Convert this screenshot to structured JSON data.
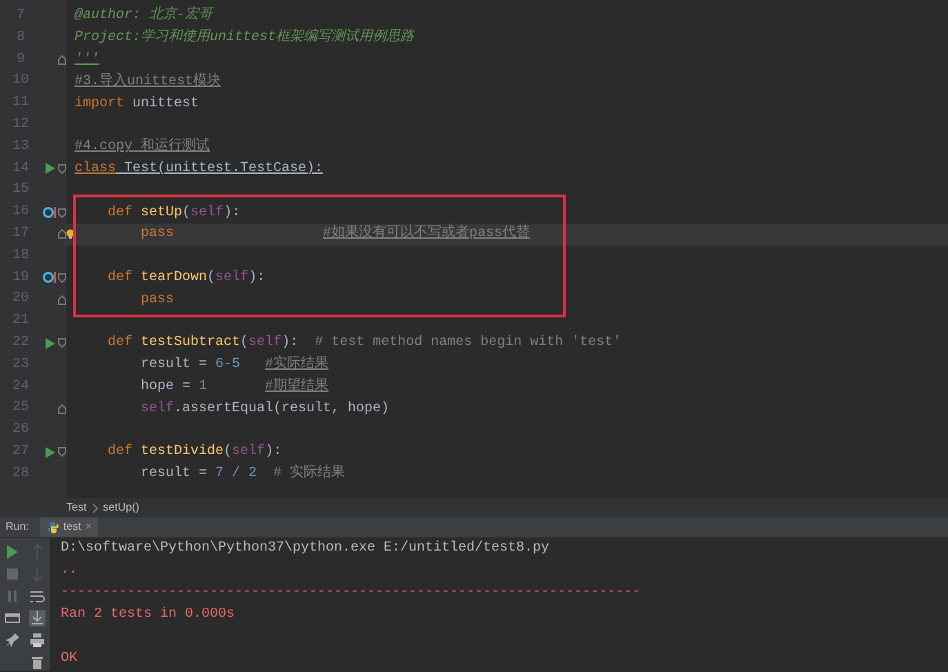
{
  "editor": {
    "items": [
      {
        "kind": "line",
        "number": "7",
        "current": false,
        "tokens": [
          {
            "text": "@author: 北京-宏哥",
            "kind": "docstring",
            "underlined": false
          }
        ]
      },
      {
        "kind": "line",
        "number": "8",
        "current": false,
        "tokens": [
          {
            "text": "Project:学习和使用unittest框架编写测试用例思路",
            "kind": "docstring",
            "underlined": false
          }
        ]
      },
      {
        "kind": "line",
        "number": "9",
        "current": false,
        "gutter_icons": [
          {
            "kind": "fold-end"
          }
        ],
        "tokens": [
          {
            "text": "'''",
            "kind": "docstring",
            "underlined": true
          }
        ]
      },
      {
        "kind": "line",
        "number": "10",
        "current": false,
        "tokens": [
          {
            "text": "#3.导入unittest模块",
            "kind": "comment",
            "underlined": true
          }
        ]
      },
      {
        "kind": "line",
        "number": "11",
        "current": false,
        "tokens": [
          {
            "text": "import ",
            "kind": "keyword",
            "underlined": false
          },
          {
            "text": "unittest",
            "kind": "plain",
            "underlined": false
          }
        ]
      },
      {
        "kind": "line",
        "number": "12",
        "current": false
      },
      {
        "kind": "line",
        "number": "13",
        "current": false,
        "tokens": [
          {
            "text": "#4.copy 和运行测试",
            "kind": "comment",
            "underlined": true
          }
        ]
      },
      {
        "kind": "line",
        "number": "14",
        "current": false,
        "gutter_icons": [
          {
            "kind": "run"
          },
          {
            "kind": "fold-start"
          }
        ],
        "tokens": [
          {
            "text": "class",
            "kind": "keyword",
            "underlined": true
          },
          {
            "text": " Test(unittest.TestCase):",
            "kind": "plain",
            "underlined": true
          }
        ]
      },
      {
        "kind": "line",
        "number": "15",
        "current": false
      },
      {
        "kind": "frame",
        "lines": [
          {
            "kind": "line",
            "number": "16",
            "current": false,
            "gutter_icons": [
              {
                "kind": "override"
              },
              {
                "kind": "fold-start"
              }
            ],
            "tokens": [
              {
                "text": "    def ",
                "kind": "keyword",
                "underlined": false
              },
              {
                "text": "setUp",
                "kind": "function",
                "underlined": false
              },
              {
                "text": "(",
                "kind": "plain",
                "underlined": false
              },
              {
                "text": "self",
                "kind": "self",
                "underlined": false
              },
              {
                "text": "):",
                "kind": "plain",
                "underlined": false
              }
            ]
          },
          {
            "kind": "line",
            "number": "17",
            "current": true,
            "gutter_icons": [
              {
                "kind": "fold-end"
              },
              {
                "kind": "bulb"
              }
            ],
            "tokens": [
              {
                "text": "        pass                  ",
                "kind": "keyword",
                "underlined": false
              },
              {
                "text": "#如果没有可以不写或者pass代替",
                "kind": "comment",
                "underlined": true
              }
            ]
          },
          {
            "kind": "line",
            "number": "18",
            "current": false
          },
          {
            "kind": "line",
            "number": "19",
            "current": false,
            "gutter_icons": [
              {
                "kind": "override"
              },
              {
                "kind": "fold-start"
              }
            ],
            "tokens": [
              {
                "text": "    def ",
                "kind": "keyword",
                "underlined": false
              },
              {
                "text": "tearDown",
                "kind": "function",
                "underlined": false
              },
              {
                "text": "(",
                "kind": "plain",
                "underlined": false
              },
              {
                "text": "self",
                "kind": "self",
                "underlined": false
              },
              {
                "text": "):",
                "kind": "plain",
                "underlined": false
              }
            ]
          },
          {
            "kind": "line",
            "number": "20",
            "current": false,
            "gutter_icons": [
              {
                "kind": "fold-end"
              }
            ],
            "tokens": [
              {
                "text": "        pass",
                "kind": "keyword",
                "underlined": false
              }
            ]
          }
        ]
      },
      {
        "kind": "line",
        "number": "21",
        "current": false
      },
      {
        "kind": "line",
        "number": "22",
        "current": false,
        "gutter_icons": [
          {
            "kind": "run"
          },
          {
            "kind": "fold-start"
          }
        ],
        "tokens": [
          {
            "text": "    def ",
            "kind": "keyword",
            "underlined": false
          },
          {
            "text": "testSubtract",
            "kind": "function",
            "underlined": false
          },
          {
            "text": "(",
            "kind": "plain",
            "underlined": false
          },
          {
            "text": "self",
            "kind": "self",
            "underlined": false
          },
          {
            "text": "):",
            "kind": "plain",
            "underlined": false
          },
          {
            "text": "  # test method names begin with 'test'",
            "kind": "comment",
            "underlined": false
          }
        ]
      },
      {
        "kind": "line",
        "number": "23",
        "current": false,
        "tokens": [
          {
            "text": "        result = ",
            "kind": "plain",
            "underlined": false
          },
          {
            "text": "6-5   ",
            "kind": "number",
            "underlined": false
          },
          {
            "text": "#实际结果",
            "kind": "comment",
            "underlined": true
          }
        ]
      },
      {
        "kind": "line",
        "number": "24",
        "current": false,
        "tokens": [
          {
            "text": "        hope = ",
            "kind": "plain",
            "underlined": false
          },
          {
            "text": "1       ",
            "kind": "number",
            "underlined": false
          },
          {
            "text": "#期望结果",
            "kind": "comment",
            "underlined": true
          }
        ]
      },
      {
        "kind": "line",
        "number": "25",
        "current": false,
        "gutter_icons": [
          {
            "kind": "fold-end"
          }
        ],
        "tokens": [
          {
            "text": "        self",
            "kind": "self",
            "underlined": false
          },
          {
            "text": ".assertEqual(result, hope)",
            "kind": "plain",
            "underlined": false
          }
        ]
      },
      {
        "kind": "line",
        "number": "26",
        "current": false
      },
      {
        "kind": "line",
        "number": "27",
        "current": false,
        "gutter_icons": [
          {
            "kind": "run"
          },
          {
            "kind": "fold-start"
          }
        ],
        "tokens": [
          {
            "text": "    def ",
            "kind": "keyword",
            "underlined": false
          },
          {
            "text": "testDivide",
            "kind": "function",
            "underlined": false
          },
          {
            "text": "(",
            "kind": "plain",
            "underlined": false
          },
          {
            "text": "self",
            "kind": "self",
            "underlined": false
          },
          {
            "text": "):",
            "kind": "plain",
            "underlined": false
          }
        ]
      },
      {
        "kind": "line",
        "number": "28",
        "current": false,
        "tokens": [
          {
            "text": "        result = ",
            "kind": "plain",
            "underlined": false
          },
          {
            "text": "7 / 2",
            "kind": "number",
            "underlined": false
          },
          {
            "text": "  # 实际结果",
            "kind": "comment",
            "underlined": false
          }
        ]
      }
    ]
  },
  "breadcrumb": [
    "Test",
    "setUp()"
  ],
  "run_panel": {
    "label": "Run:",
    "tab": {
      "title": "test",
      "close": "×"
    },
    "toolbar_left": [
      {
        "kind": "run",
        "selected": false
      },
      {
        "kind": "stop",
        "selected": false
      },
      {
        "kind": "pause",
        "selected": false
      },
      {
        "kind": "layout",
        "selected": false
      },
      {
        "kind": "pin",
        "selected": false
      }
    ],
    "toolbar_right": [
      {
        "kind": "up",
        "selected": false
      },
      {
        "kind": "down",
        "selected": false
      },
      {
        "kind": "wrap",
        "selected": false
      },
      {
        "kind": "scrollend",
        "selected": true
      },
      {
        "kind": "print",
        "selected": false
      },
      {
        "kind": "trash",
        "selected": false
      }
    ],
    "console": [
      {
        "text": "D:\\software\\Python\\Python37\\python.exe E:/untitled/test8.py",
        "kind": "command"
      },
      {
        "text": "..",
        "kind": "stderr"
      },
      {
        "text": "----------------------------------------------------------------------",
        "kind": "stderr"
      },
      {
        "text": "Ran 2 tests in 0.000s",
        "kind": "stderr"
      },
      {
        "kind": "blank"
      },
      {
        "text": "OK",
        "kind": "stderr"
      }
    ]
  }
}
